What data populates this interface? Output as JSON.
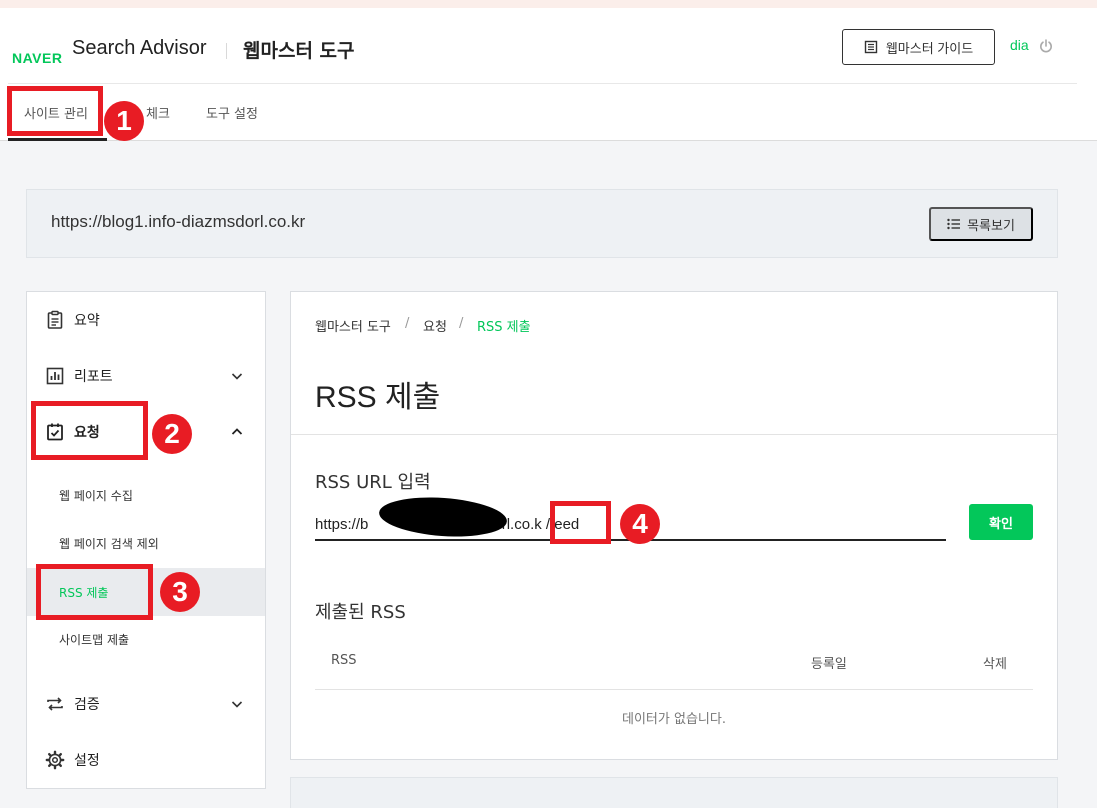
{
  "header": {
    "logo": "NAVER",
    "brand": "Search Advisor",
    "tool_title": "웹마스터 도구",
    "guide_button": "웹마스터 가이드",
    "user": "dia"
  },
  "nav": {
    "tabs": [
      {
        "label": "사이트 관리"
      },
      {
        "label": "체크"
      },
      {
        "label": "도구 설정"
      }
    ]
  },
  "site": {
    "url": "https://blog1.info-diazmsdorl.co.kr",
    "list_button": "목록보기"
  },
  "sidebar": {
    "items": [
      {
        "label": "요약",
        "icon": "clipboard-icon"
      },
      {
        "label": "리포트",
        "icon": "chart-icon"
      },
      {
        "label": "요청",
        "icon": "check-clipboard-icon"
      },
      {
        "label": "검증",
        "icon": "repeat-icon"
      },
      {
        "label": "설정",
        "icon": "gear-icon"
      }
    ],
    "sub_items": [
      {
        "label": "웹 페이지 수집"
      },
      {
        "label": "웹 페이지 검색 제외"
      },
      {
        "label": "RSS 제출"
      },
      {
        "label": "사이트맵 제출"
      }
    ]
  },
  "main": {
    "breadcrumb": [
      "웹마스터 도구",
      "요청",
      "RSS 제출"
    ],
    "breadcrumb_sep": "/",
    "title": "RSS 제출",
    "input_label": "RSS URL 입력",
    "input_value": "https://b                              orl.co.k /feed",
    "confirm_button": "확인",
    "submitted_title": "제출된 RSS",
    "table_headers": [
      "RSS",
      "등록일",
      "삭제"
    ],
    "empty_message": "데이터가 없습니다."
  },
  "annotations": [
    "1",
    "2",
    "3",
    "4"
  ],
  "colors": {
    "accent": "#03c75a",
    "annotation": "#e81c24"
  }
}
